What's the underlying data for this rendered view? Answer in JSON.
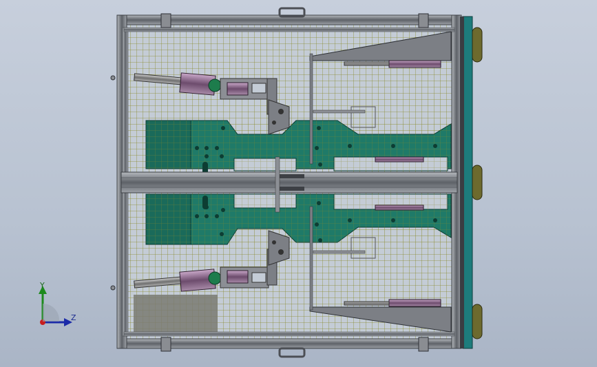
{
  "viewport": {
    "background_top": "#c7cfdc",
    "background_bottom": "#aab5c6"
  },
  "model": {
    "frame_color": "#6a6e74",
    "frame_highlight": "#b4b8bd",
    "mesh_color": "#8a8a2a",
    "plate_color": "#1f7a68",
    "cylinder_color": "#7a5a7a",
    "bracket_color": "#7c7f85",
    "wheel_color": "#6d6a2e",
    "side_bar_color": "#1d7c7c",
    "grey_block_color": "#7a7a72"
  },
  "triad": {
    "y_label": "Y",
    "z_label": "Z",
    "y_color": "#1d8a1d",
    "z_color": "#1b2aa8",
    "x_color": "#c81e1e"
  }
}
